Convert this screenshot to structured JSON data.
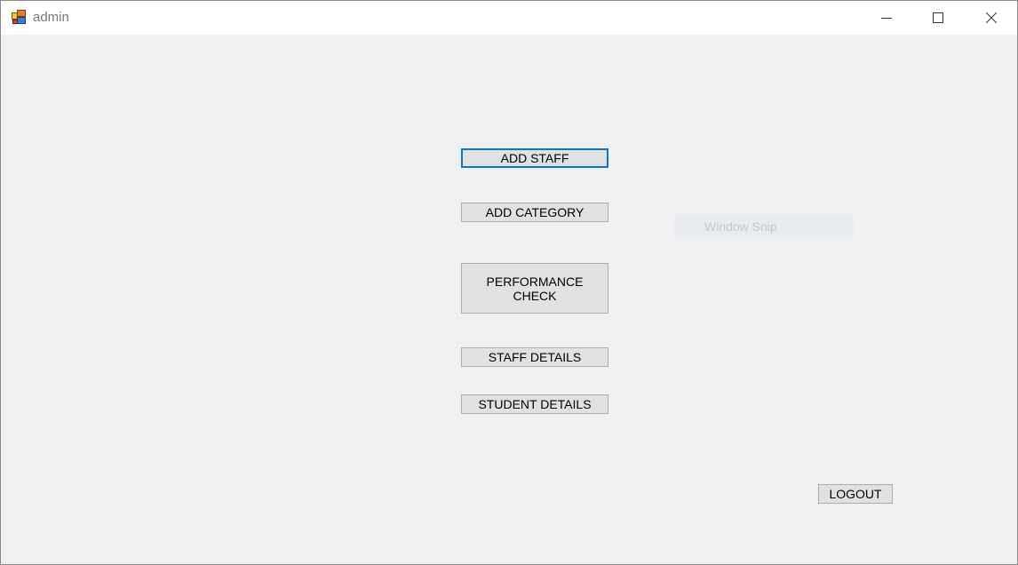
{
  "window": {
    "title": "admin",
    "icons": {
      "app": "app-icon",
      "minimize": "minimize-icon",
      "maximize": "maximize-icon",
      "close": "close-icon"
    }
  },
  "menu": {
    "add_staff": "ADD STAFF",
    "add_category": "ADD CATEGORY",
    "performance_check": "PERFORMANCE\nCHECK",
    "staff_details": "STAFF DETAILS",
    "student_details": "STUDENT DETAILS"
  },
  "logout_label": "LOGOUT",
  "snip_overlay_text": "Window Snip",
  "colors": {
    "focus_border": "#0078d7",
    "button_face": "#e1e1e1",
    "background": "#f0f0f0"
  }
}
